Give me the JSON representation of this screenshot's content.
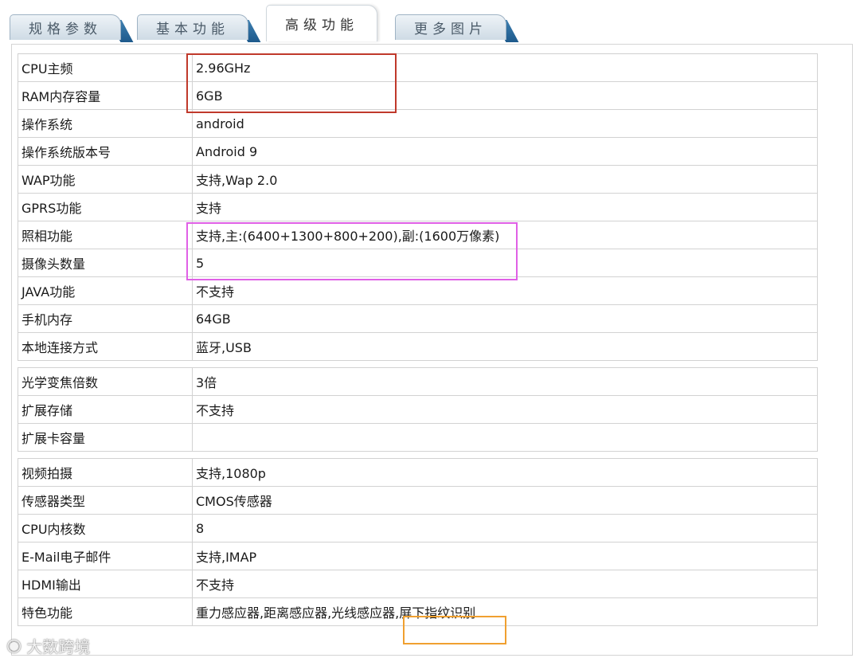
{
  "tabs": [
    {
      "label": "规格参数",
      "active": false
    },
    {
      "label": "基本功能",
      "active": false
    },
    {
      "label": "高级功能",
      "active": true
    },
    {
      "label": "更多图片",
      "active": false
    }
  ],
  "rows": [
    {
      "key": "CPU主频",
      "value": "2.96GHz"
    },
    {
      "key": "RAM内存容量",
      "value": "6GB"
    },
    {
      "key": "操作系统",
      "value": "android"
    },
    {
      "key": "操作系统版本号",
      "value": "Android 9"
    },
    {
      "key": "WAP功能",
      "value": "支持,Wap 2.0"
    },
    {
      "key": "GPRS功能",
      "value": "支持"
    },
    {
      "key": "照相功能",
      "value": "支持,主:(6400+1300+800+200),副:(1600万像素)"
    },
    {
      "key": "摄像头数量",
      "value": "5"
    },
    {
      "key": "JAVA功能",
      "value": "不支持"
    },
    {
      "key": "手机内存",
      "value": "64GB"
    },
    {
      "key": "本地连接方式",
      "value": "蓝牙,USB"
    },
    {
      "key": "光学变焦倍数",
      "value": "3倍"
    },
    {
      "key": "扩展存储",
      "value": "不支持"
    },
    {
      "key": "扩展卡容量",
      "value": ""
    },
    {
      "key": "视频拍摄",
      "value": "支持,1080p"
    },
    {
      "key": "传感器类型",
      "value": "CMOS传感器"
    },
    {
      "key": "CPU内核数",
      "value": "8"
    },
    {
      "key": "E-Mail电子邮件",
      "value": "支持,IMAP"
    },
    {
      "key": "HDMI输出",
      "value": "不支持"
    },
    {
      "key": "特色功能",
      "value": "重力感应器,距离感应器,光线感应器,屏下指纹识别"
    }
  ],
  "highlight_colors": {
    "red": "#c0392b",
    "pink": "#e060e6",
    "orange": "#f0a030"
  },
  "watermark": {
    "icon": "wechat-icon",
    "text": "大数跨境"
  }
}
